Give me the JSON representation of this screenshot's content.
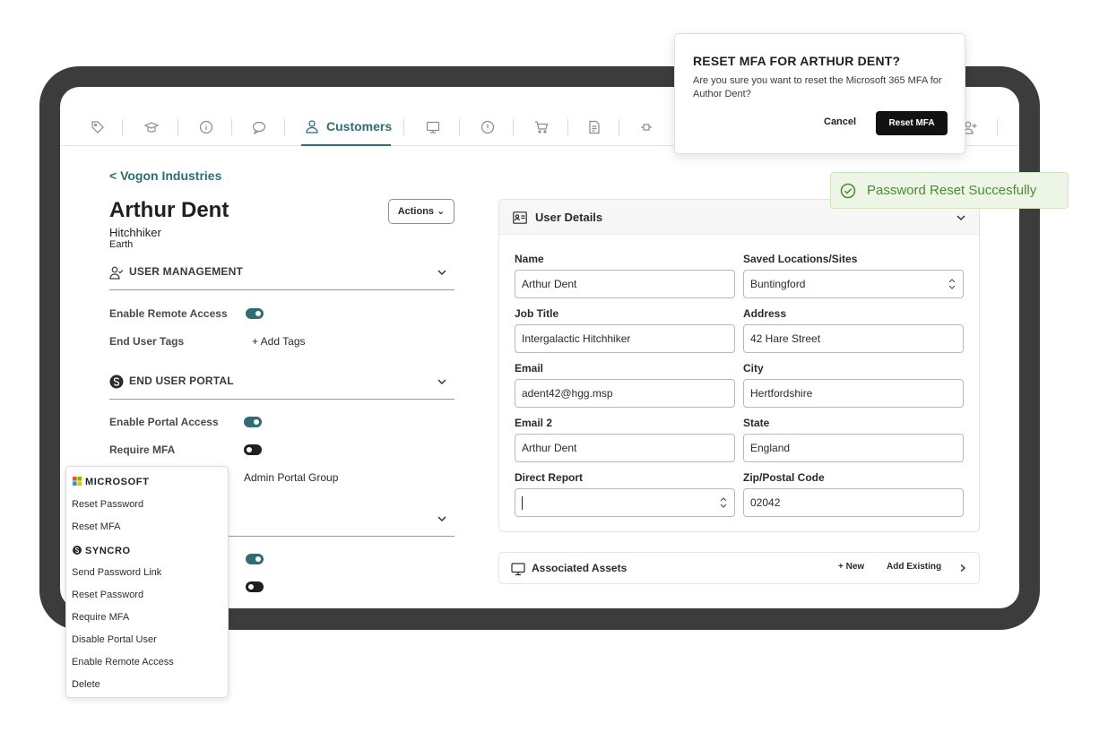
{
  "colors": {
    "accent": "#2e6e73",
    "device_frame": "#3c3c3c",
    "success_text": "#4c8a32",
    "success_bg": "#edf6e6",
    "primary_button": "#121212"
  },
  "nav": {
    "icons": [
      "tag-icon",
      "graduation-cap-icon",
      "info-icon",
      "chat-icon",
      "customers-icon",
      "monitor-icon",
      "alert-icon",
      "cart-icon",
      "document-icon",
      "plug-icon",
      "add-user-icon"
    ],
    "active_tab_label": "Customers"
  },
  "breadcrumb": "< Vogon Industries",
  "user": {
    "name": "Arthur Dent",
    "title": "Hitchhiker",
    "location": "Earth"
  },
  "actions_button": "Actions",
  "user_management": {
    "title": "USER MANAGEMENT",
    "enable_remote_access_label": "Enable Remote Access",
    "enable_remote_access": true,
    "end_user_tags_label": "End User Tags",
    "add_tags_label": "+ Add Tags"
  },
  "end_user_portal": {
    "title": "END USER PORTAL",
    "enable_portal_access_label": "Enable Portal Access",
    "enable_portal_access": true,
    "require_mfa_label": "Require MFA",
    "require_mfa": false,
    "portal_group_value": "Admin Portal Group"
  },
  "third_section": {
    "toggle_1": true,
    "toggle_2": false
  },
  "user_details": {
    "title": "User Details",
    "fields": {
      "name": {
        "label": "Name",
        "value": "Arthur Dent"
      },
      "saved_locations": {
        "label": "Saved Locations/Sites",
        "value": "Buntingford"
      },
      "job_title": {
        "label": "Job Title",
        "value": "Intergalactic Hitchhiker"
      },
      "address": {
        "label": "Address",
        "value": "42 Hare Street"
      },
      "email": {
        "label": "Email",
        "value": "adent42@hgg.msp"
      },
      "city": {
        "label": "City",
        "value": "Hertfordshire"
      },
      "email2": {
        "label": "Email 2",
        "value": "Arthur Dent"
      },
      "state": {
        "label": "State",
        "value": "England"
      },
      "direct_report": {
        "label": "Direct Report",
        "value": ""
      },
      "zip": {
        "label": "Zip/Postal Code",
        "value": "02042"
      }
    }
  },
  "associated_assets": {
    "title": "Associated Assets",
    "new_label": "+ New",
    "add_existing_label": "Add Existing"
  },
  "actions_menu": {
    "microsoft_title": "MICROSOFT",
    "microsoft_items": [
      "Reset Password",
      "Reset MFA"
    ],
    "syncro_title": "SYNCRO",
    "syncro_items": [
      "Send Password Link",
      "Reset Password",
      "Require MFA",
      "Disable Portal User",
      "Enable Remote Access",
      "Delete"
    ]
  },
  "dialog": {
    "title": "RESET MFA FOR ARTHUR DENT?",
    "body": "Are you sure you want to reset the Microsoft 365 MFA for Author Dent?",
    "cancel_label": "Cancel",
    "confirm_label": "Reset MFA"
  },
  "toast": {
    "message": "Password Reset Succesfully"
  }
}
